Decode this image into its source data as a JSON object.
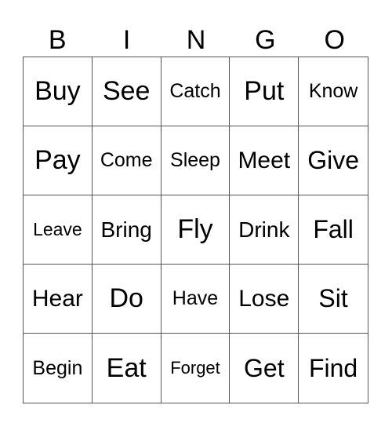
{
  "header": [
    "B",
    "I",
    "N",
    "G",
    "O"
  ],
  "cells": [
    [
      "Buy",
      "See",
      "Catch",
      "Put",
      "Know"
    ],
    [
      "Pay",
      "Come",
      "Sleep",
      "Meet",
      "Give"
    ],
    [
      "Leave",
      "Bring",
      "Fly",
      "Drink",
      "Fall"
    ],
    [
      "Hear",
      "Do",
      "Have",
      "Lose",
      "Sit"
    ],
    [
      "Begin",
      "Eat",
      "Forget",
      "Get",
      "Find"
    ]
  ]
}
